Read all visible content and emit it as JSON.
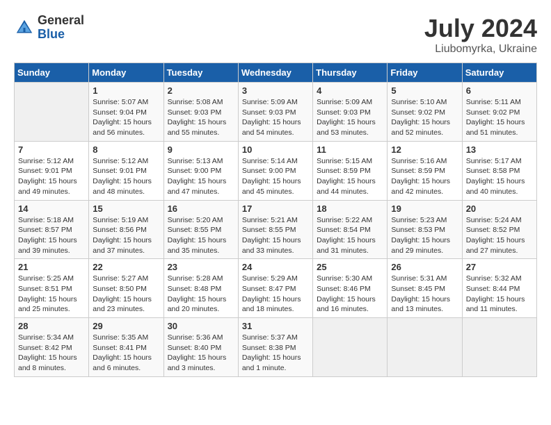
{
  "header": {
    "logo_general": "General",
    "logo_blue": "Blue",
    "month_year": "July 2024",
    "location": "Liubomyrka, Ukraine"
  },
  "weekdays": [
    "Sunday",
    "Monday",
    "Tuesday",
    "Wednesday",
    "Thursday",
    "Friday",
    "Saturday"
  ],
  "weeks": [
    [
      {
        "day": "",
        "info": ""
      },
      {
        "day": "1",
        "info": "Sunrise: 5:07 AM\nSunset: 9:04 PM\nDaylight: 15 hours\nand 56 minutes."
      },
      {
        "day": "2",
        "info": "Sunrise: 5:08 AM\nSunset: 9:03 PM\nDaylight: 15 hours\nand 55 minutes."
      },
      {
        "day": "3",
        "info": "Sunrise: 5:09 AM\nSunset: 9:03 PM\nDaylight: 15 hours\nand 54 minutes."
      },
      {
        "day": "4",
        "info": "Sunrise: 5:09 AM\nSunset: 9:03 PM\nDaylight: 15 hours\nand 53 minutes."
      },
      {
        "day": "5",
        "info": "Sunrise: 5:10 AM\nSunset: 9:02 PM\nDaylight: 15 hours\nand 52 minutes."
      },
      {
        "day": "6",
        "info": "Sunrise: 5:11 AM\nSunset: 9:02 PM\nDaylight: 15 hours\nand 51 minutes."
      }
    ],
    [
      {
        "day": "7",
        "info": "Sunrise: 5:12 AM\nSunset: 9:01 PM\nDaylight: 15 hours\nand 49 minutes."
      },
      {
        "day": "8",
        "info": "Sunrise: 5:12 AM\nSunset: 9:01 PM\nDaylight: 15 hours\nand 48 minutes."
      },
      {
        "day": "9",
        "info": "Sunrise: 5:13 AM\nSunset: 9:00 PM\nDaylight: 15 hours\nand 47 minutes."
      },
      {
        "day": "10",
        "info": "Sunrise: 5:14 AM\nSunset: 9:00 PM\nDaylight: 15 hours\nand 45 minutes."
      },
      {
        "day": "11",
        "info": "Sunrise: 5:15 AM\nSunset: 8:59 PM\nDaylight: 15 hours\nand 44 minutes."
      },
      {
        "day": "12",
        "info": "Sunrise: 5:16 AM\nSunset: 8:59 PM\nDaylight: 15 hours\nand 42 minutes."
      },
      {
        "day": "13",
        "info": "Sunrise: 5:17 AM\nSunset: 8:58 PM\nDaylight: 15 hours\nand 40 minutes."
      }
    ],
    [
      {
        "day": "14",
        "info": "Sunrise: 5:18 AM\nSunset: 8:57 PM\nDaylight: 15 hours\nand 39 minutes."
      },
      {
        "day": "15",
        "info": "Sunrise: 5:19 AM\nSunset: 8:56 PM\nDaylight: 15 hours\nand 37 minutes."
      },
      {
        "day": "16",
        "info": "Sunrise: 5:20 AM\nSunset: 8:55 PM\nDaylight: 15 hours\nand 35 minutes."
      },
      {
        "day": "17",
        "info": "Sunrise: 5:21 AM\nSunset: 8:55 PM\nDaylight: 15 hours\nand 33 minutes."
      },
      {
        "day": "18",
        "info": "Sunrise: 5:22 AM\nSunset: 8:54 PM\nDaylight: 15 hours\nand 31 minutes."
      },
      {
        "day": "19",
        "info": "Sunrise: 5:23 AM\nSunset: 8:53 PM\nDaylight: 15 hours\nand 29 minutes."
      },
      {
        "day": "20",
        "info": "Sunrise: 5:24 AM\nSunset: 8:52 PM\nDaylight: 15 hours\nand 27 minutes."
      }
    ],
    [
      {
        "day": "21",
        "info": "Sunrise: 5:25 AM\nSunset: 8:51 PM\nDaylight: 15 hours\nand 25 minutes."
      },
      {
        "day": "22",
        "info": "Sunrise: 5:27 AM\nSunset: 8:50 PM\nDaylight: 15 hours\nand 23 minutes."
      },
      {
        "day": "23",
        "info": "Sunrise: 5:28 AM\nSunset: 8:48 PM\nDaylight: 15 hours\nand 20 minutes."
      },
      {
        "day": "24",
        "info": "Sunrise: 5:29 AM\nSunset: 8:47 PM\nDaylight: 15 hours\nand 18 minutes."
      },
      {
        "day": "25",
        "info": "Sunrise: 5:30 AM\nSunset: 8:46 PM\nDaylight: 15 hours\nand 16 minutes."
      },
      {
        "day": "26",
        "info": "Sunrise: 5:31 AM\nSunset: 8:45 PM\nDaylight: 15 hours\nand 13 minutes."
      },
      {
        "day": "27",
        "info": "Sunrise: 5:32 AM\nSunset: 8:44 PM\nDaylight: 15 hours\nand 11 minutes."
      }
    ],
    [
      {
        "day": "28",
        "info": "Sunrise: 5:34 AM\nSunset: 8:42 PM\nDaylight: 15 hours\nand 8 minutes."
      },
      {
        "day": "29",
        "info": "Sunrise: 5:35 AM\nSunset: 8:41 PM\nDaylight: 15 hours\nand 6 minutes."
      },
      {
        "day": "30",
        "info": "Sunrise: 5:36 AM\nSunset: 8:40 PM\nDaylight: 15 hours\nand 3 minutes."
      },
      {
        "day": "31",
        "info": "Sunrise: 5:37 AM\nSunset: 8:38 PM\nDaylight: 15 hours\nand 1 minute."
      },
      {
        "day": "",
        "info": ""
      },
      {
        "day": "",
        "info": ""
      },
      {
        "day": "",
        "info": ""
      }
    ]
  ]
}
